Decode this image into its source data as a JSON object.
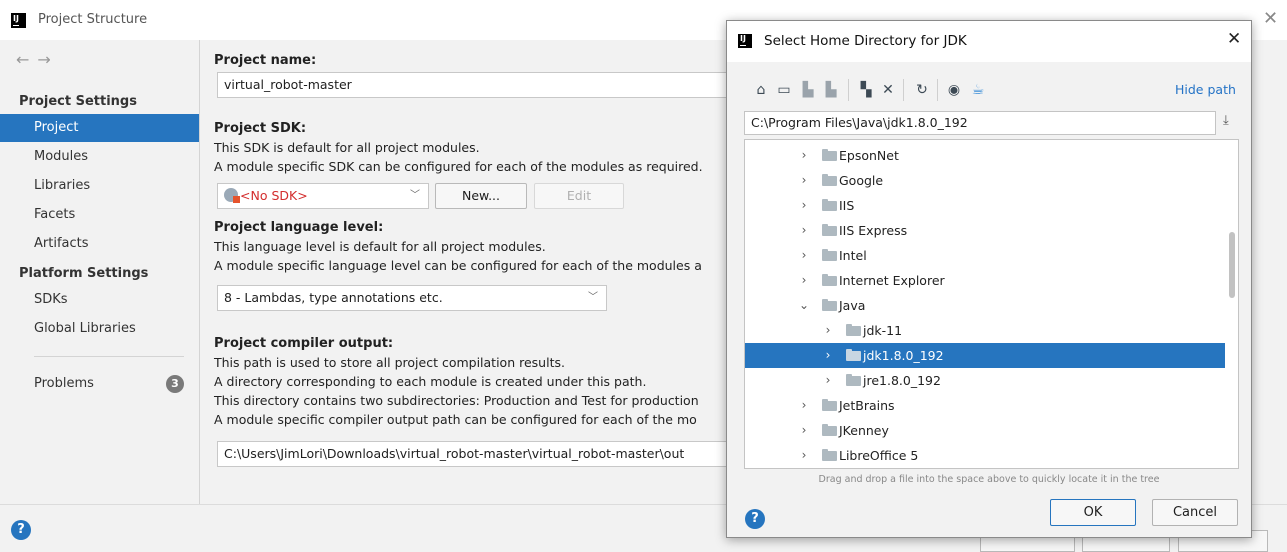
{
  "window": {
    "title": "Project Structure"
  },
  "sidebar": {
    "sections": [
      {
        "label": "Project Settings",
        "items": [
          "Project",
          "Modules",
          "Libraries",
          "Facets",
          "Artifacts"
        ]
      },
      {
        "label": "Platform Settings",
        "items": [
          "SDKs",
          "Global Libraries"
        ]
      }
    ],
    "selected": "Project",
    "problems": {
      "label": "Problems",
      "count": "3"
    }
  },
  "content": {
    "project_name_label": "Project name:",
    "project_name_value": "virtual_robot-master",
    "sdk_label": "Project SDK:",
    "sdk_desc1": "This SDK is default for all project modules.",
    "sdk_desc2": "A module specific SDK can be configured for each of the modules as required.",
    "sdk_value": "<No SDK>",
    "new_button": "New...",
    "edit_button": "Edit",
    "lang_label": "Project language level:",
    "lang_desc1": "This language level is default for all project modules.",
    "lang_desc2": "A module specific language level can be configured for each of the modules a",
    "lang_value": "8 - Lambdas, type annotations etc.",
    "compiler_label": "Project compiler output:",
    "compiler_desc1": "This path is used to store all project compilation results.",
    "compiler_desc2": "A directory corresponding to each module is created under this path.",
    "compiler_desc3": "This directory contains two subdirectories: Production and Test for production",
    "compiler_desc4": "A module specific compiler output path can be configured for each of the mo",
    "compiler_value": "C:\\Users\\JimLori\\Downloads\\virtual_robot-master\\virtual_robot-master\\out"
  },
  "dialog": {
    "title": "Select Home Directory for JDK",
    "hide_path": "Hide path",
    "path_value": "C:\\Program Files\\Java\\jdk1.8.0_192",
    "tree": [
      {
        "name": "EpsonNet",
        "level": 0,
        "expanded": false
      },
      {
        "name": "Google",
        "level": 0,
        "expanded": false
      },
      {
        "name": "IIS",
        "level": 0,
        "expanded": false
      },
      {
        "name": "IIS Express",
        "level": 0,
        "expanded": false
      },
      {
        "name": "Intel",
        "level": 0,
        "expanded": false
      },
      {
        "name": "Internet Explorer",
        "level": 0,
        "expanded": false
      },
      {
        "name": "Java",
        "level": 0,
        "expanded": true
      },
      {
        "name": "jdk-11",
        "level": 1,
        "expanded": false
      },
      {
        "name": "jdk1.8.0_192",
        "level": 1,
        "expanded": false,
        "selected": true
      },
      {
        "name": "jre1.8.0_192",
        "level": 1,
        "expanded": false
      },
      {
        "name": "JetBrains",
        "level": 0,
        "expanded": false
      },
      {
        "name": "JKenney",
        "level": 0,
        "expanded": false
      },
      {
        "name": "LibreOffice 5",
        "level": 0,
        "expanded": false
      }
    ],
    "hint": "Drag and drop a file into the space above to quickly locate it in the tree",
    "ok_button": "OK",
    "cancel_button": "Cancel"
  },
  "toolbar_icons": [
    "home-icon",
    "desktop-icon",
    "project-icon",
    "module-icon",
    "new-folder-icon",
    "delete-icon",
    "refresh-icon",
    "show-hidden-icon",
    "jdk-icon"
  ],
  "colors": {
    "selection": "#2675bf",
    "link": "#2473c6",
    "error": "#d32d2d"
  }
}
